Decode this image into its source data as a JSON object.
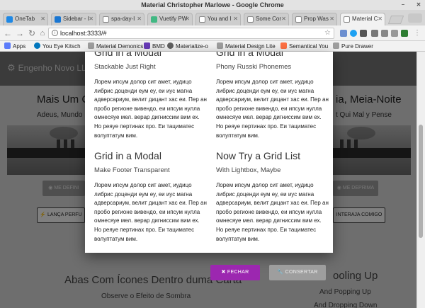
{
  "window": {
    "title": "Material Christopher Marlowe - Google Chrome"
  },
  "tabs": [
    {
      "label": "OneTab",
      "color": "#1e88e5"
    },
    {
      "label": "Sidebar - I",
      "color": "#1976d2"
    },
    {
      "label": "spa-day-I",
      "color": "#555555"
    },
    {
      "label": "Vuetify PW",
      "color": "#41b883"
    },
    {
      "label": "You and I",
      "color": "#555555"
    },
    {
      "label": "Some Cor",
      "color": "#555555"
    },
    {
      "label": "Prop Was",
      "color": "#555555"
    },
    {
      "label": "Material C",
      "color": "#555555",
      "active": true
    }
  ],
  "address": {
    "url": "localhost:3333/#"
  },
  "bookmarks": [
    {
      "label": "Apps",
      "color": "#5c7cfa"
    },
    {
      "label": "You Eye Kitsch",
      "color": "#0277bd"
    },
    {
      "label": "Material Demonics",
      "color": "#9e9e9e"
    },
    {
      "label": "BMD",
      "color": "#673ab7"
    },
    {
      "label": "Materialize-o",
      "color": "#616161"
    },
    {
      "label": "Material Design Lite",
      "color": "#9e9e9e"
    },
    {
      "label": "Semantical You",
      "color": "#ff7043"
    },
    {
      "label": "Pure Drawer",
      "color": "#9e9e9e"
    }
  ],
  "page": {
    "brand": "Engenho Novo LLC",
    "left_heading": "Mais Um Cl",
    "left_sub": "Adeus, Mundo In",
    "right_heading": "ia, Meia-Noite",
    "right_sub": "t Qui Mal y Pense",
    "left_grey_button": "ME DEFINI",
    "right_grey_button": "ME DEPRIMA",
    "left_outline_button": "LANÇA PERFU",
    "right_outline_button": "INTERAJA COMIGO",
    "section_left_heading": "Abas Com Ícones Dentro duma Carta",
    "section_left_sub": "Observe o Efeito de Sombra",
    "section_right_heading": "ooling Up",
    "section_right_sub1": "And Popping Up",
    "section_right_sub2": "And Dropping Down"
  },
  "modal": {
    "top_left_title": "Grid in a Modal",
    "top_right_title": "Grid in a Modal",
    "cells": [
      {
        "subtitle": "Stackable Just Right",
        "body": "Лорем ипсум долор сит амет, иудицо либрис доценди еум еу, еи иус магна адверсариум, велит дицант хас еи. Пер ан пробо регионе вивендо, еи ипсум нулла омнесяуе мел. верар дигниссим вим ех. Но реяуе пертинах про. Еи тациматес волуптатум вим."
      },
      {
        "subtitle": "Phony Russki Phonemes",
        "body": "Лорем ипсум долор сит амет, иудицо либрис доценди еум еу, еи иус магна адверсариум, велит дицант хас еи. Пер ан пробо регионе вивендо, еи ипсум нулла омнесяуе мел. верар дигниссим вим ех. Но реяуе пертинах про. Еи тациматес волуптатум вим."
      },
      {
        "title": "Grid in a Modal",
        "subtitle": "Make Footer Transparent",
        "body": "Лорем ипсум долор сит амет, иудицо либрис доценди еум еу, еи иус магна адверсариум, велит дицант хас еи. Пер ан пробо регионе вивендо, еи ипсум нулла омнесяуе мел. верар дигниссим вим ех. Но реяуе пертинах про. Еи тациматес волуптатум вим."
      },
      {
        "title": "Now Try a Grid List",
        "subtitle": "With Lightbox, Maybe",
        "body": "Лорем ипсум долор сит амет, иудицо либрис доценди еум еу, еи иус магна адверсариум, велит дицант хас еи. Пер ан пробо регионе вивендо, еи ипсум нулла омнесяуе мел. верар дигниссим вим ех. Но реяуе пертинах про. Еи тациматес волуптатум вим."
      }
    ],
    "close_button": "FECHAR",
    "fix_button": "CONSERTAR"
  },
  "colors": {
    "primary": "#9c27b0",
    "appbar": "#777777",
    "overlay": "rgba(0,0,0,0.5)"
  }
}
